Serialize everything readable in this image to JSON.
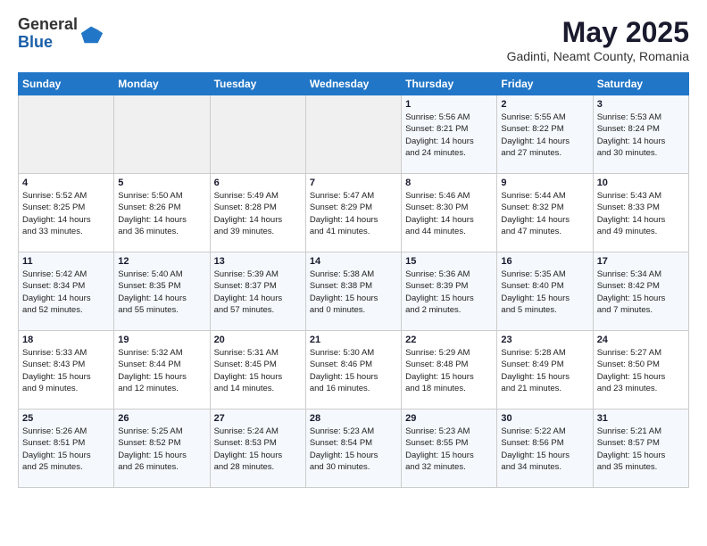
{
  "header": {
    "logo_line1": "General",
    "logo_line2": "Blue",
    "title": "May 2025",
    "subtitle": "Gadinti, Neamt County, Romania"
  },
  "weekdays": [
    "Sunday",
    "Monday",
    "Tuesday",
    "Wednesday",
    "Thursday",
    "Friday",
    "Saturday"
  ],
  "weeks": [
    [
      {
        "day": "",
        "info": ""
      },
      {
        "day": "",
        "info": ""
      },
      {
        "day": "",
        "info": ""
      },
      {
        "day": "",
        "info": ""
      },
      {
        "day": "1",
        "info": "Sunrise: 5:56 AM\nSunset: 8:21 PM\nDaylight: 14 hours\nand 24 minutes."
      },
      {
        "day": "2",
        "info": "Sunrise: 5:55 AM\nSunset: 8:22 PM\nDaylight: 14 hours\nand 27 minutes."
      },
      {
        "day": "3",
        "info": "Sunrise: 5:53 AM\nSunset: 8:24 PM\nDaylight: 14 hours\nand 30 minutes."
      }
    ],
    [
      {
        "day": "4",
        "info": "Sunrise: 5:52 AM\nSunset: 8:25 PM\nDaylight: 14 hours\nand 33 minutes."
      },
      {
        "day": "5",
        "info": "Sunrise: 5:50 AM\nSunset: 8:26 PM\nDaylight: 14 hours\nand 36 minutes."
      },
      {
        "day": "6",
        "info": "Sunrise: 5:49 AM\nSunset: 8:28 PM\nDaylight: 14 hours\nand 39 minutes."
      },
      {
        "day": "7",
        "info": "Sunrise: 5:47 AM\nSunset: 8:29 PM\nDaylight: 14 hours\nand 41 minutes."
      },
      {
        "day": "8",
        "info": "Sunrise: 5:46 AM\nSunset: 8:30 PM\nDaylight: 14 hours\nand 44 minutes."
      },
      {
        "day": "9",
        "info": "Sunrise: 5:44 AM\nSunset: 8:32 PM\nDaylight: 14 hours\nand 47 minutes."
      },
      {
        "day": "10",
        "info": "Sunrise: 5:43 AM\nSunset: 8:33 PM\nDaylight: 14 hours\nand 49 minutes."
      }
    ],
    [
      {
        "day": "11",
        "info": "Sunrise: 5:42 AM\nSunset: 8:34 PM\nDaylight: 14 hours\nand 52 minutes."
      },
      {
        "day": "12",
        "info": "Sunrise: 5:40 AM\nSunset: 8:35 PM\nDaylight: 14 hours\nand 55 minutes."
      },
      {
        "day": "13",
        "info": "Sunrise: 5:39 AM\nSunset: 8:37 PM\nDaylight: 14 hours\nand 57 minutes."
      },
      {
        "day": "14",
        "info": "Sunrise: 5:38 AM\nSunset: 8:38 PM\nDaylight: 15 hours\nand 0 minutes."
      },
      {
        "day": "15",
        "info": "Sunrise: 5:36 AM\nSunset: 8:39 PM\nDaylight: 15 hours\nand 2 minutes."
      },
      {
        "day": "16",
        "info": "Sunrise: 5:35 AM\nSunset: 8:40 PM\nDaylight: 15 hours\nand 5 minutes."
      },
      {
        "day": "17",
        "info": "Sunrise: 5:34 AM\nSunset: 8:42 PM\nDaylight: 15 hours\nand 7 minutes."
      }
    ],
    [
      {
        "day": "18",
        "info": "Sunrise: 5:33 AM\nSunset: 8:43 PM\nDaylight: 15 hours\nand 9 minutes."
      },
      {
        "day": "19",
        "info": "Sunrise: 5:32 AM\nSunset: 8:44 PM\nDaylight: 15 hours\nand 12 minutes."
      },
      {
        "day": "20",
        "info": "Sunrise: 5:31 AM\nSunset: 8:45 PM\nDaylight: 15 hours\nand 14 minutes."
      },
      {
        "day": "21",
        "info": "Sunrise: 5:30 AM\nSunset: 8:46 PM\nDaylight: 15 hours\nand 16 minutes."
      },
      {
        "day": "22",
        "info": "Sunrise: 5:29 AM\nSunset: 8:48 PM\nDaylight: 15 hours\nand 18 minutes."
      },
      {
        "day": "23",
        "info": "Sunrise: 5:28 AM\nSunset: 8:49 PM\nDaylight: 15 hours\nand 21 minutes."
      },
      {
        "day": "24",
        "info": "Sunrise: 5:27 AM\nSunset: 8:50 PM\nDaylight: 15 hours\nand 23 minutes."
      }
    ],
    [
      {
        "day": "25",
        "info": "Sunrise: 5:26 AM\nSunset: 8:51 PM\nDaylight: 15 hours\nand 25 minutes."
      },
      {
        "day": "26",
        "info": "Sunrise: 5:25 AM\nSunset: 8:52 PM\nDaylight: 15 hours\nand 26 minutes."
      },
      {
        "day": "27",
        "info": "Sunrise: 5:24 AM\nSunset: 8:53 PM\nDaylight: 15 hours\nand 28 minutes."
      },
      {
        "day": "28",
        "info": "Sunrise: 5:23 AM\nSunset: 8:54 PM\nDaylight: 15 hours\nand 30 minutes."
      },
      {
        "day": "29",
        "info": "Sunrise: 5:23 AM\nSunset: 8:55 PM\nDaylight: 15 hours\nand 32 minutes."
      },
      {
        "day": "30",
        "info": "Sunrise: 5:22 AM\nSunset: 8:56 PM\nDaylight: 15 hours\nand 34 minutes."
      },
      {
        "day": "31",
        "info": "Sunrise: 5:21 AM\nSunset: 8:57 PM\nDaylight: 15 hours\nand 35 minutes."
      }
    ]
  ]
}
